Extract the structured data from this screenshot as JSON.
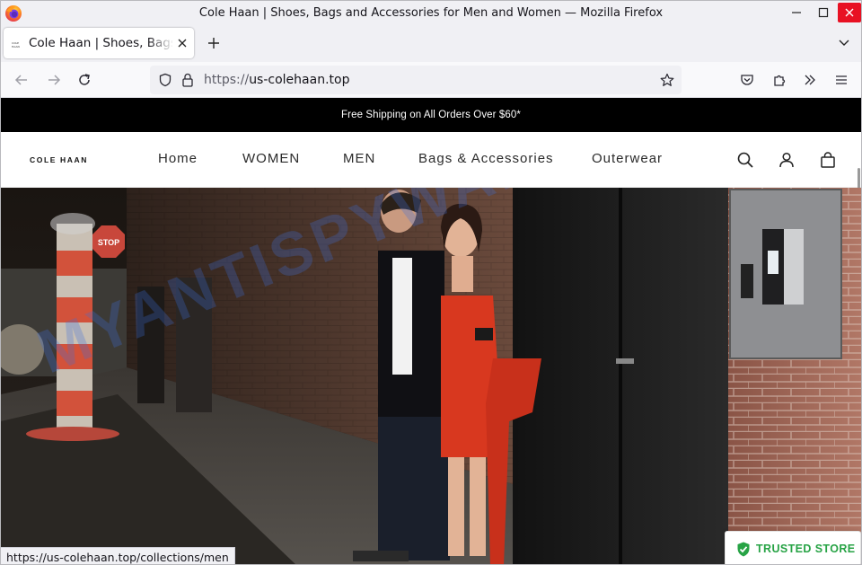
{
  "window": {
    "title": "Cole Haan | Shoes, Bags and Accessories for Men and Women — Mozilla Firefox"
  },
  "tab": {
    "title": "Cole Haan | Shoes, Bags and Accessories for Men and Women",
    "favicon_text": "COLE HAAN"
  },
  "urlbar": {
    "protocol": "https://",
    "host": "us-colehaan.top"
  },
  "site": {
    "announcement": "Free Shipping on All Orders Over $60*",
    "logo": "COLE HAAN",
    "nav": [
      "Home",
      "WOMEN",
      "MEN",
      "Bags & Accessories",
      "Outerwear"
    ],
    "watermark": "MYANTISPYWARE.COM",
    "stop_sign": "STOP"
  },
  "status_bar": {
    "url": "https://us-colehaan.top/collections/men"
  },
  "badge": {
    "label": "TRUSTED STORE",
    "color": "#27a345"
  },
  "icons": {
    "browser": "firefox-icon",
    "back": "arrow-left-icon",
    "forward": "arrow-right-icon",
    "reload": "reload-icon",
    "shield": "tracking-shield-icon",
    "lock": "lock-icon",
    "bookmark": "star-icon",
    "pocket": "pocket-icon",
    "extensions": "puzzle-icon",
    "overflow": "chevrons-right-icon",
    "menu": "hamburger-icon",
    "search": "search-icon",
    "account": "user-icon",
    "bag": "shopping-bag-icon"
  }
}
